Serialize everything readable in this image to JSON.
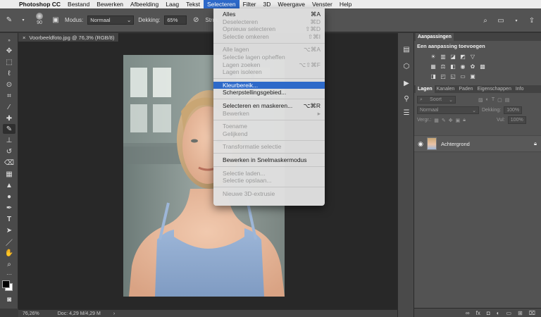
{
  "menubar": {
    "apple_icon": "apple-icon",
    "items": [
      "Photoshop CC",
      "Bestand",
      "Bewerken",
      "Afbeelding",
      "Laag",
      "Tekst",
      "Selecteren",
      "Filter",
      "3D",
      "Weergave",
      "Venster",
      "Help"
    ],
    "active_index": 6
  },
  "options": {
    "brush_size": "90",
    "mode_label": "Modus:",
    "mode_value": "Normaal",
    "opacity_label": "Dekking:",
    "opacity_value": "65%",
    "flow_label": "Strm:",
    "flow_value": "1"
  },
  "document": {
    "tab_title": "Voorbeeldfoto.jpg @ 76,3% (RGB/8)",
    "zoom": "76,26%",
    "doc_info": "Doc: 4,29 M/4,29 M"
  },
  "menu": {
    "groups": [
      [
        {
          "label": "Alles",
          "shortcut": "⌘A",
          "enabled": true
        },
        {
          "label": "Deselecteren",
          "shortcut": "⌘D",
          "enabled": false
        },
        {
          "label": "Opnieuw selecteren",
          "shortcut": "⇧⌘D",
          "enabled": false
        },
        {
          "label": "Selectie omkeren",
          "shortcut": "⇧⌘I",
          "enabled": false
        }
      ],
      [
        {
          "label": "Alle lagen",
          "shortcut": "⌥⌘A",
          "enabled": false
        },
        {
          "label": "Selectie lagen opheffen",
          "shortcut": "",
          "enabled": false
        },
        {
          "label": "Lagen zoeken",
          "shortcut": "⌥⇧⌘F",
          "enabled": false
        },
        {
          "label": "Lagen isoleren",
          "shortcut": "",
          "enabled": false
        }
      ],
      [
        {
          "label": "Kleurbereik...",
          "shortcut": "",
          "enabled": true,
          "highlighted": true
        },
        {
          "label": "Scherpstellingsgebied...",
          "shortcut": "",
          "enabled": true
        }
      ],
      [
        {
          "label": "Selecteren en maskeren...",
          "shortcut": "⌥⌘R",
          "enabled": true
        },
        {
          "label": "Bewerken",
          "shortcut": "▸",
          "enabled": false
        }
      ],
      [
        {
          "label": "Toename",
          "shortcut": "",
          "enabled": false
        },
        {
          "label": "Gelijkend",
          "shortcut": "",
          "enabled": false
        }
      ],
      [
        {
          "label": "Transformatie selectie",
          "shortcut": "",
          "enabled": false
        }
      ],
      [
        {
          "label": "Bewerken in Snelmaskermodus",
          "shortcut": "",
          "enabled": true
        }
      ],
      [
        {
          "label": "Selectie laden...",
          "shortcut": "",
          "enabled": false
        },
        {
          "label": "Selectie opslaan...",
          "shortcut": "",
          "enabled": false
        }
      ],
      [
        {
          "label": "Nieuwe 3D-extrusie",
          "shortcut": "",
          "enabled": false
        }
      ]
    ]
  },
  "panels": {
    "adjustments_tab": "Aanpassingen",
    "adjustments_title": "Een aanpassing toevoegen",
    "layer_tabs": [
      "Lagen",
      "Kanalen",
      "Paden",
      "Eigenschappen",
      "Info"
    ],
    "search_placeholder": "Soort",
    "blend_mode": "Normaal",
    "opacity_label": "Dekking:",
    "opacity_value": "100%",
    "lock_label": "Vergr.:",
    "fill_label": "Vul:",
    "fill_value": "100%",
    "layer_name": "Achtergrond"
  },
  "colors": {
    "menu_highlight": "#2d69c9",
    "workspace": "#282828",
    "panel": "#535353"
  }
}
